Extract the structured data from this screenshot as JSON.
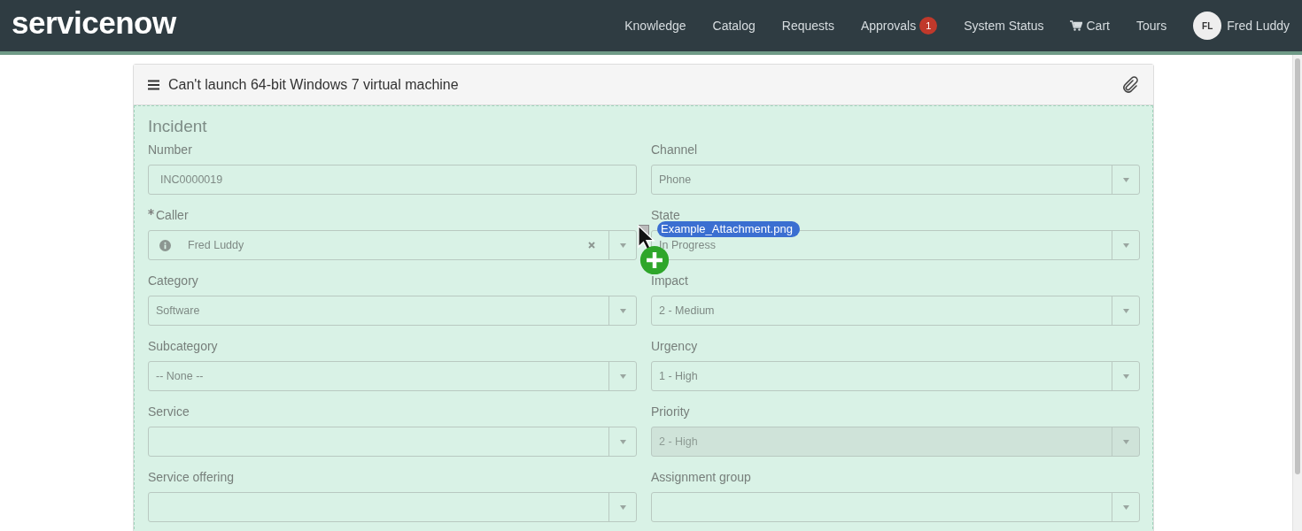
{
  "header": {
    "logo": "servicenow",
    "nav": [
      {
        "label": "Knowledge",
        "kind": "link"
      },
      {
        "label": "Catalog",
        "kind": "link"
      },
      {
        "label": "Requests",
        "kind": "link"
      },
      {
        "label": "Approvals",
        "kind": "badge",
        "badge": "1"
      },
      {
        "label": "System Status",
        "kind": "link"
      },
      {
        "label": "Cart",
        "kind": "cart"
      },
      {
        "label": "Tours",
        "kind": "link"
      }
    ],
    "user": {
      "initials": "FL",
      "name": "Fred Luddy"
    }
  },
  "record": {
    "title": "Can't launch 64-bit Windows 7 virtual machine",
    "section": "Incident",
    "fields": [
      {
        "label": "Number",
        "kind": "text",
        "value": "INC0000019",
        "required": false,
        "disabled": false
      },
      {
        "label": "Channel",
        "kind": "select",
        "value": "Phone",
        "required": false,
        "disabled": false
      },
      {
        "label": "Caller",
        "kind": "reference",
        "value": "Fred Luddy",
        "required": true,
        "disabled": false
      },
      {
        "label": "State",
        "kind": "select",
        "value": "In Progress",
        "required": false,
        "disabled": false
      },
      {
        "label": "Category",
        "kind": "select",
        "value": "Software",
        "required": false,
        "disabled": false
      },
      {
        "label": "Impact",
        "kind": "select",
        "value": "2 - Medium",
        "required": false,
        "disabled": false
      },
      {
        "label": "Subcategory",
        "kind": "select",
        "value": "-- None --",
        "required": false,
        "disabled": false
      },
      {
        "label": "Urgency",
        "kind": "select",
        "value": "1 - High",
        "required": false,
        "disabled": false
      },
      {
        "label": "Service",
        "kind": "select",
        "required": false,
        "disabled": false
      },
      {
        "label": "Priority",
        "kind": "select",
        "value": "2 - High",
        "required": false,
        "disabled": true
      },
      {
        "label": "Service offering",
        "kind": "select",
        "required": false,
        "disabled": false
      },
      {
        "label": "Assignment group",
        "kind": "select",
        "required": false,
        "disabled": false
      }
    ]
  },
  "drag": {
    "file": "Example_Attachment.png"
  }
}
